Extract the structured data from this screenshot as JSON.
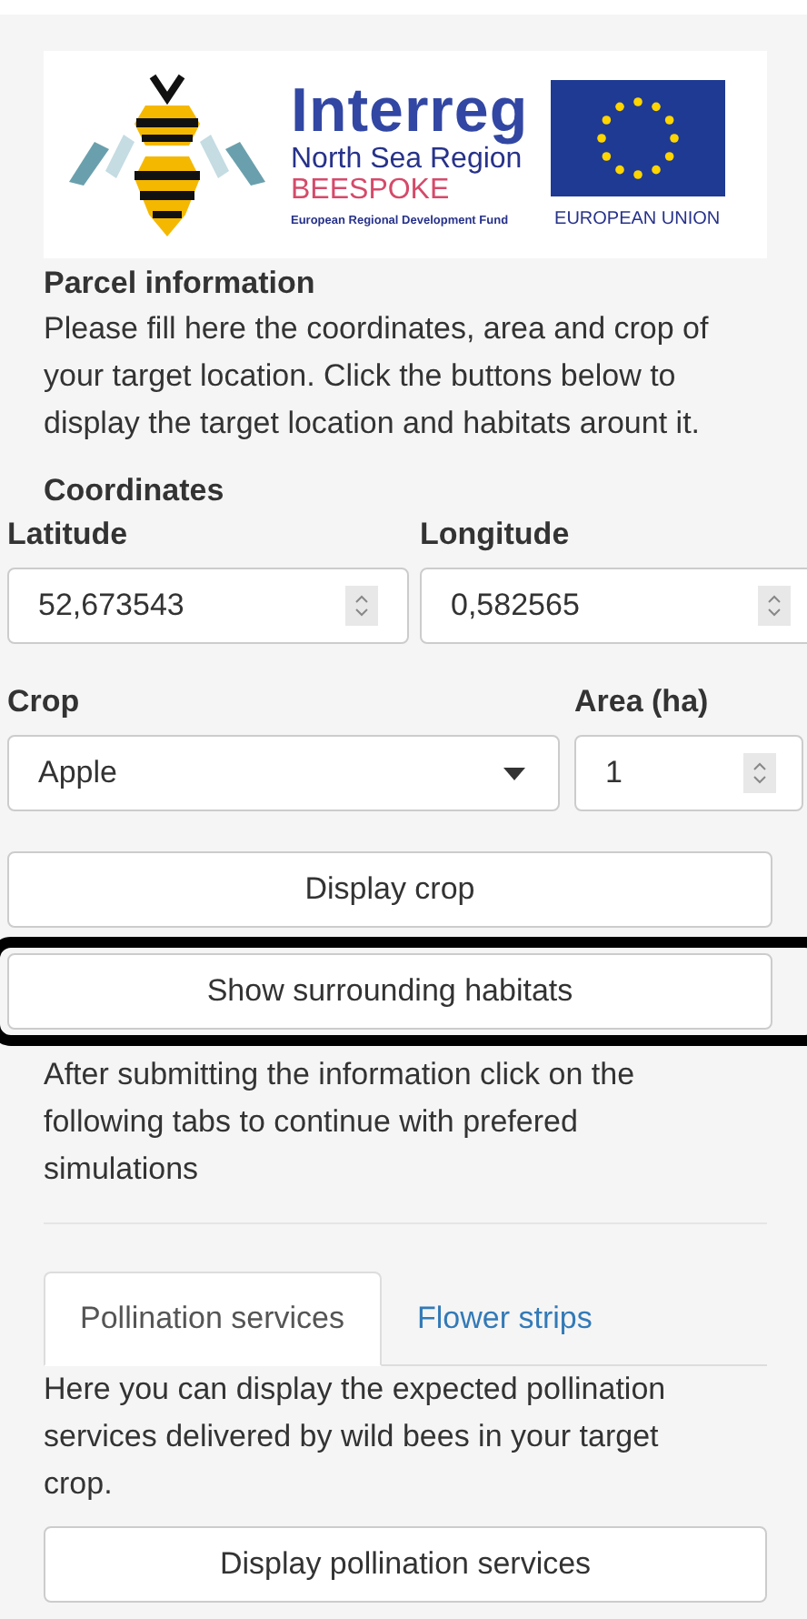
{
  "logo": {
    "title": "Interreg",
    "region": "North Sea Region",
    "project": "BEESPOKE",
    "fund": "European Regional Development Fund",
    "union": "EUROPEAN UNION"
  },
  "parcel": {
    "heading": "Parcel information",
    "text": "Please fill here the coordinates, area and crop of your target location. Click the buttons below to display the target location and habitats arount it."
  },
  "coordinates": {
    "heading": "Coordinates",
    "fields": [
      {
        "label": "Latitude",
        "value": "52,673543"
      },
      {
        "label": "Longitude",
        "value": "0,582565"
      }
    ]
  },
  "crop": {
    "label": "Crop",
    "value": "Apple"
  },
  "area": {
    "label": "Area (ha)",
    "value": "1"
  },
  "buttons": [
    {
      "label": "Display crop",
      "highlighted": false
    },
    {
      "label": "Show surrounding habitats",
      "highlighted": true
    }
  ],
  "note": "After submitting the information click on the following tabs to continue with prefered simulations",
  "tabs": [
    {
      "label": "Pollination services",
      "selected": true
    },
    {
      "label": "Flower strips",
      "selected": false
    }
  ],
  "tab_content": {
    "text": "Here you can display the expected pollination services delivered by wild bees in your target crop.",
    "button": "Display pollination services"
  }
}
